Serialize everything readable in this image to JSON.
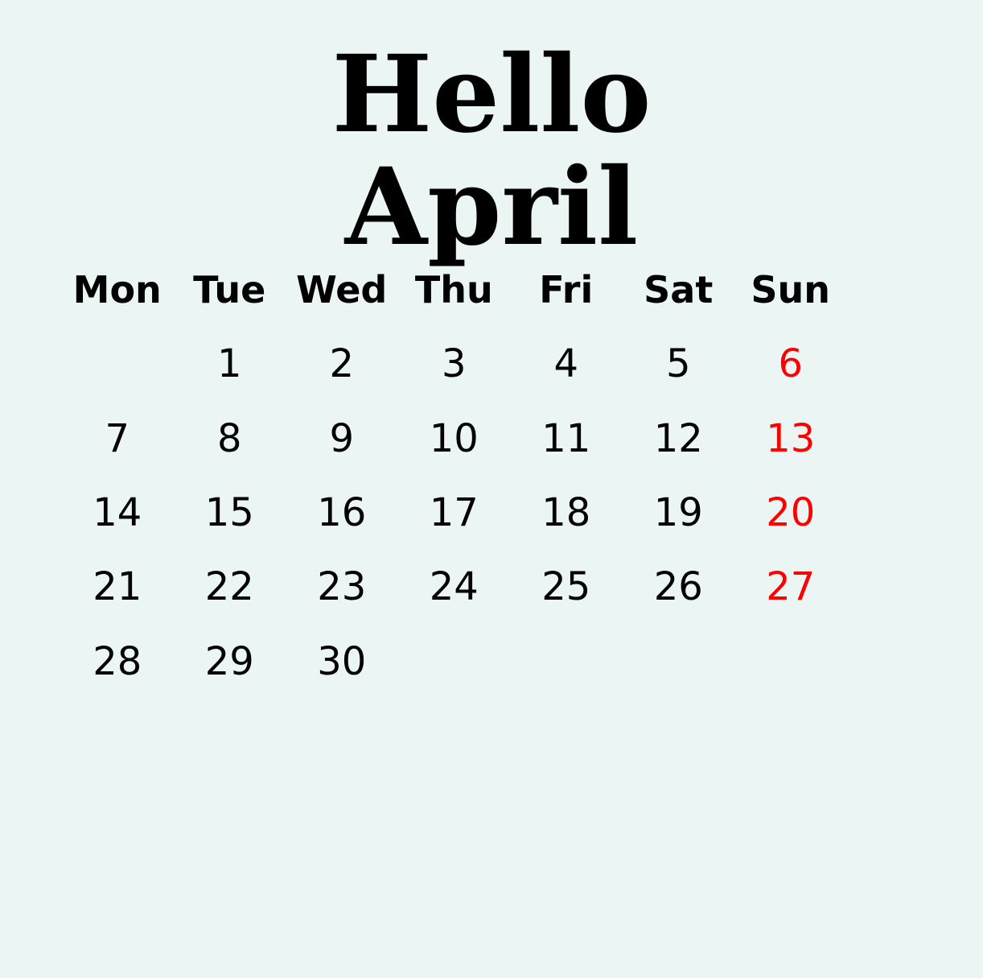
{
  "title": {
    "line1": "Hello",
    "line2": "April"
  },
  "weekdays": [
    "Mon",
    "Tue",
    "Wed",
    "Thu",
    "Fri",
    "Sat",
    "Sun"
  ],
  "weeks": [
    [
      "",
      "1",
      "2",
      "3",
      "4",
      "5",
      "6"
    ],
    [
      "7",
      "8",
      "9",
      "10",
      "11",
      "12",
      "13"
    ],
    [
      "14",
      "15",
      "16",
      "17",
      "18",
      "19",
      "20"
    ],
    [
      "21",
      "22",
      "23",
      "24",
      "25",
      "26",
      "27"
    ],
    [
      "28",
      "29",
      "30",
      "",
      "",
      "",
      ""
    ]
  ],
  "colors": {
    "background": "#eaf5f4",
    "sunday": "#ff0000",
    "text": "#000000"
  }
}
